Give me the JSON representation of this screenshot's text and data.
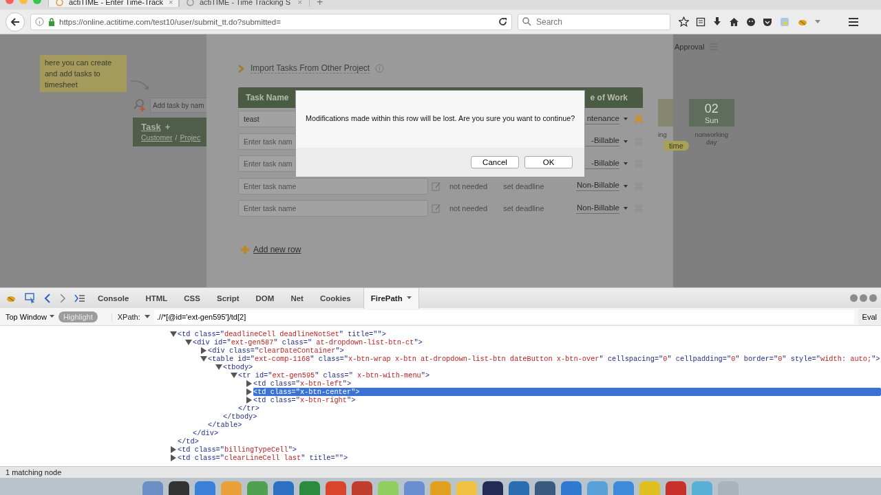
{
  "browser": {
    "tabs": [
      {
        "title": "actiTIME - Enter Time-Track",
        "close": "×",
        "selected": true
      },
      {
        "title": "actiTIME - Time Tracking S",
        "close": "×",
        "selected": false
      }
    ],
    "new_tab": "+",
    "url": "https://online.actitime.com/test10/user/submit_tt.do?submitted=",
    "search": {
      "placeholder": "Search"
    }
  },
  "page": {
    "tip": "here you can create and add tasks to timesheet",
    "task_search": {
      "placeholder": "Add task by nam"
    },
    "task_column": {
      "title": "Task",
      "sort": "+",
      "customer": "Customer",
      "separator": "/",
      "project": "Projec"
    },
    "import_link": "Import Tasks From Other Project",
    "table": {
      "columns": [
        "Task Name",
        "e of Work"
      ],
      "rows": [
        {
          "value": "teast",
          "placeholder": "",
          "estimate": "",
          "deadline": "",
          "billing": "ntenance",
          "delete_active": true
        },
        {
          "value": "",
          "placeholder": "Enter task nam",
          "estimate": "",
          "deadline": "",
          "billing": "-Billable",
          "delete_active": false
        },
        {
          "value": "",
          "placeholder": "Enter task nam",
          "estimate": "",
          "deadline": "",
          "billing": "-Billable",
          "delete_active": false
        },
        {
          "value": "",
          "placeholder": "Enter task name",
          "estimate": "not needed",
          "deadline": "set deadline",
          "billing": "Non-Billable",
          "delete_active": false
        },
        {
          "value": "",
          "placeholder": "Enter task name",
          "estimate": "not needed",
          "deadline": "set deadline",
          "billing": "Non-Billable",
          "delete_active": false
        }
      ]
    },
    "add_row": "Add new row",
    "approval": "Approval",
    "day": {
      "number": "02",
      "weekday": "Sun",
      "partial_note": "ing",
      "note": "nonworking day",
      "badge": "time"
    }
  },
  "dialog": {
    "message": "Modifications made within this row will be lost. Are you sure you want to continue?",
    "buttons": [
      "Cancel",
      "OK"
    ]
  },
  "devtools": {
    "tabs": [
      {
        "label": "Console",
        "selected": false,
        "menu": false
      },
      {
        "label": "HTML",
        "selected": false,
        "menu": false
      },
      {
        "label": "CSS",
        "selected": false,
        "menu": false
      },
      {
        "label": "Script",
        "selected": false,
        "menu": false
      },
      {
        "label": "DOM",
        "selected": false,
        "menu": false
      },
      {
        "label": "Net",
        "selected": false,
        "menu": false
      },
      {
        "label": "Cookies",
        "selected": false,
        "menu": false
      },
      {
        "label": "FirePath",
        "selected": true,
        "menu": true
      }
    ],
    "context": "Top Window",
    "highlight": "Highlight",
    "xpath_label": "XPath:",
    "xpath": ".//*[@id='ext-gen595']/td[2]",
    "eval": "Eval",
    "tree": [
      {
        "tag": "<td class=\"deadlineCell deadlineNotSet\" title=\"\">",
        "expanded": true,
        "selected": false,
        "closing": "</td>",
        "children": [
          {
            "tag": "<div id=\"ext-gen587\" class=\" at-dropdown-list-btn-ct\">",
            "expanded": true,
            "selected": false,
            "closing": "</div>",
            "children": [
              {
                "tag": "<div class=\"clearDateContainer\">",
                "expanded": false,
                "selected": false
              },
              {
                "tag": "<table id=\"ext-comp-1168\" class=\"x-btn-wrap x-btn at-dropdown-list-btn dateButton x-btn-over\" cellspacing=\"0\" cellpadding=\"0\" border=\"0\" style=\"width: auto;\">",
                "expanded": true,
                "selected": false,
                "closing": "</table>",
                "children": [
                  {
                    "tag": "<tbody>",
                    "expanded": true,
                    "selected": false,
                    "closing": "</tbody>",
                    "children": [
                      {
                        "tag": "<tr id=\"ext-gen595\" class=\" x-btn-with-menu\">",
                        "expanded": true,
                        "selected": false,
                        "closing": "</tr>",
                        "children": [
                          {
                            "tag": "<td class=\"x-btn-left\">",
                            "expanded": false,
                            "selected": false
                          },
                          {
                            "tag": "<td class=\"x-btn-center\">",
                            "expanded": false,
                            "selected": true
                          },
                          {
                            "tag": "<td class=\"x-btn-right\">",
                            "expanded": false,
                            "selected": false
                          }
                        ]
                      }
                    ]
                  }
                ]
              }
            ]
          }
        ]
      },
      {
        "tag": "<td class=\"billingTypeCell\">",
        "expanded": false,
        "selected": false
      },
      {
        "tag": "<td class=\"clearLineCell last\" title=\"\">",
        "expanded": false,
        "selected": false
      }
    ],
    "status": "1 matching node"
  }
}
